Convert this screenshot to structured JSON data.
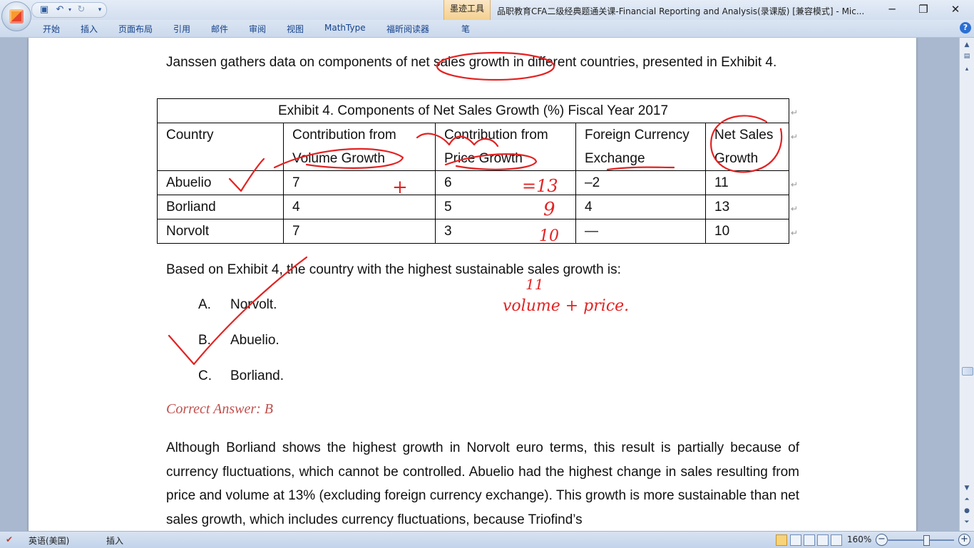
{
  "window": {
    "title": "品职教育CFA二级经典题通关课-Financial Reporting and Analysis(录课版) [兼容模式] - Mic...",
    "contextual_tab": "墨迹工具",
    "minimize": "─",
    "restore": "❐",
    "close": "✕"
  },
  "ribbon": {
    "tabs": [
      "开始",
      "插入",
      "页面布局",
      "引用",
      "邮件",
      "审阅",
      "视图",
      "MathType",
      "福昕阅读器",
      "笔"
    ],
    "help": "?"
  },
  "document": {
    "intro": "Janssen gathers data on components of net sales growth in different countries, presented in Exhibit 4.",
    "exhibit": {
      "caption": "Exhibit 4. Components of Net Sales Growth (%) Fiscal Year 2017",
      "headers": [
        "Country",
        "Contribution from Volume Growth",
        "Contribution from Price Growth",
        "Foreign Currency Exchange",
        "Net Sales Growth"
      ],
      "rows": [
        [
          "Abuelio",
          "7",
          "6",
          "–2",
          "11"
        ],
        [
          "Borliand",
          "4",
          "5",
          "4",
          "13"
        ],
        [
          "Norvolt",
          "7",
          "3",
          "—",
          "10"
        ]
      ]
    },
    "question": "Based on Exhibit 4, the country with the highest sustainable sales growth is:",
    "options": [
      {
        "letter": "A.",
        "text": "Norvolt."
      },
      {
        "letter": "B.",
        "text": "Abuelio."
      },
      {
        "letter": "C.",
        "text": "Borliand."
      }
    ],
    "answer": "Correct Answer: B",
    "explanation": "Although Borliand shows the highest growth in Norvolt euro terms, this result is partially because of currency fluctuations, which cannot be controlled. Abuelio had the highest change in sales resulting from price and volume at 13% (excluding foreign currency exchange). This growth is more sustainable than net sales growth, which includes currency fluctuations, because Triofind’s"
  },
  "annotations": {
    "plus": "+",
    "eq13": "=13",
    "nine": "9",
    "ten": "10",
    "eleven": "11",
    "formula": "volume + price."
  },
  "statusbar": {
    "language": "英语(美国)",
    "insert_mode": "插入",
    "zoom": "160%",
    "zoom_out": "−",
    "zoom_in": "+"
  },
  "colors": {
    "ink": "#e32222",
    "answer": "#c0504d",
    "workspace": "#a9b8ce"
  }
}
